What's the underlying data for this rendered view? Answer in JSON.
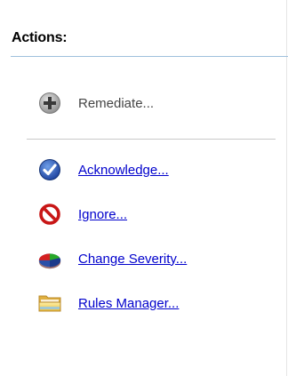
{
  "panel": {
    "title": "Actions:"
  },
  "actions": [
    {
      "label": "Remediate...",
      "icon": "plus-circle-icon",
      "enabled": false
    },
    {
      "label": "Acknowledge...",
      "icon": "check-circle-icon",
      "enabled": true
    },
    {
      "label": "Ignore...",
      "icon": "prohibited-icon",
      "enabled": true
    },
    {
      "label": "Change Severity...",
      "icon": "severity-pie-icon",
      "enabled": true
    },
    {
      "label": "Rules Manager...",
      "icon": "folder-icon",
      "enabled": true
    }
  ],
  "colors": {
    "link": "#0000cc",
    "header_line": "#9fc0dc",
    "separator": "#c8c8c8"
  }
}
